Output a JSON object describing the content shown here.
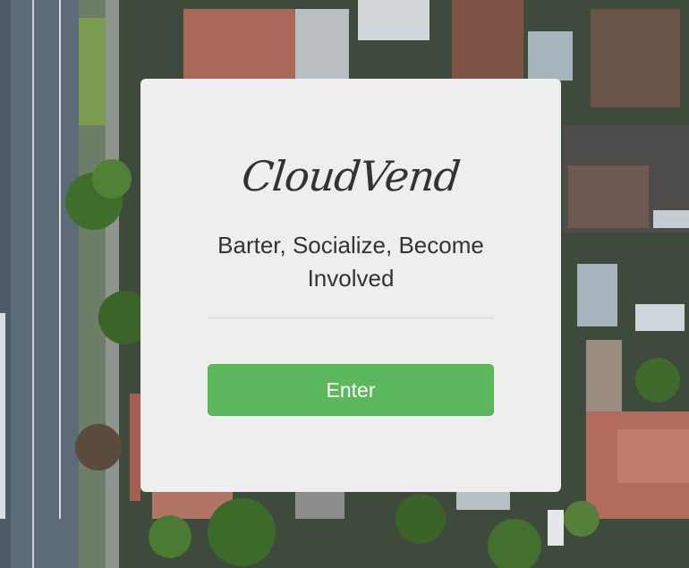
{
  "background": {
    "description_icon": "aerial-neighborhood-photo"
  },
  "landing": {
    "brand": "CloudVend",
    "tagline": "Barter, Socialize, Become Involved",
    "enter_label": "Enter"
  },
  "colors": {
    "card_bg": "#eeeeee",
    "text": "#333333",
    "button": "#5cb85c",
    "button_text": "#ffffff"
  }
}
